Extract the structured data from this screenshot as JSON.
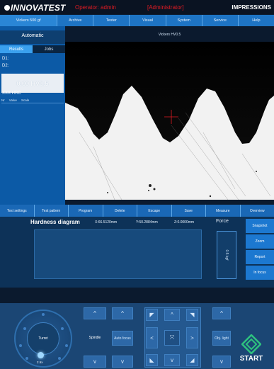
{
  "header": {
    "brand": "INNOVATEST",
    "operator": "Operator: admin",
    "role": "[Administrator]",
    "brand_right": "IMPRESSIONS"
  },
  "menu": [
    "Vickers 500 gf",
    "Archive",
    "Tester",
    "Visual",
    "System",
    "Service",
    "Help"
  ],
  "left_panel": {
    "mode": "Automatic",
    "tabs": [
      "Results",
      "Jobs"
    ],
    "d1": "D1:",
    "d2": "D2:",
    "result": "0.00 HV0.5",
    "hrc": "XXX HRC",
    "columns": [
      "Nr",
      "Value",
      "Scale"
    ]
  },
  "image_view": {
    "title": "Vickers HV0.5"
  },
  "action_bar": [
    "Test settings",
    "Test pattern",
    "Program",
    "Delete",
    "Escape",
    "Save",
    "Measure",
    "Overview"
  ],
  "diagram": {
    "title": "Hardness diagram",
    "x": "X:66.5120mm",
    "y": "Y:50.2884mm",
    "z": "Z:0.0000mm",
    "force_label": "Force",
    "force_value": "0.5 kgf"
  },
  "side_buttons": [
    "Snapshot",
    "Zoom",
    "Report",
    "In focus"
  ],
  "controls": {
    "turret_label": "Turret",
    "objective": "2.5x",
    "spindle": "Spindle",
    "autofocus": "Auto focus",
    "obj_light": "Obj. light",
    "start": "START",
    "up_glyph": "^",
    "down_glyph": "v",
    "left_glyph": "<",
    "right_glyph": ">",
    "center_glyph": "⤧"
  },
  "colors": {
    "accent": "#1e74c4",
    "alert": "#e31b23",
    "start": "#2ec27e"
  }
}
